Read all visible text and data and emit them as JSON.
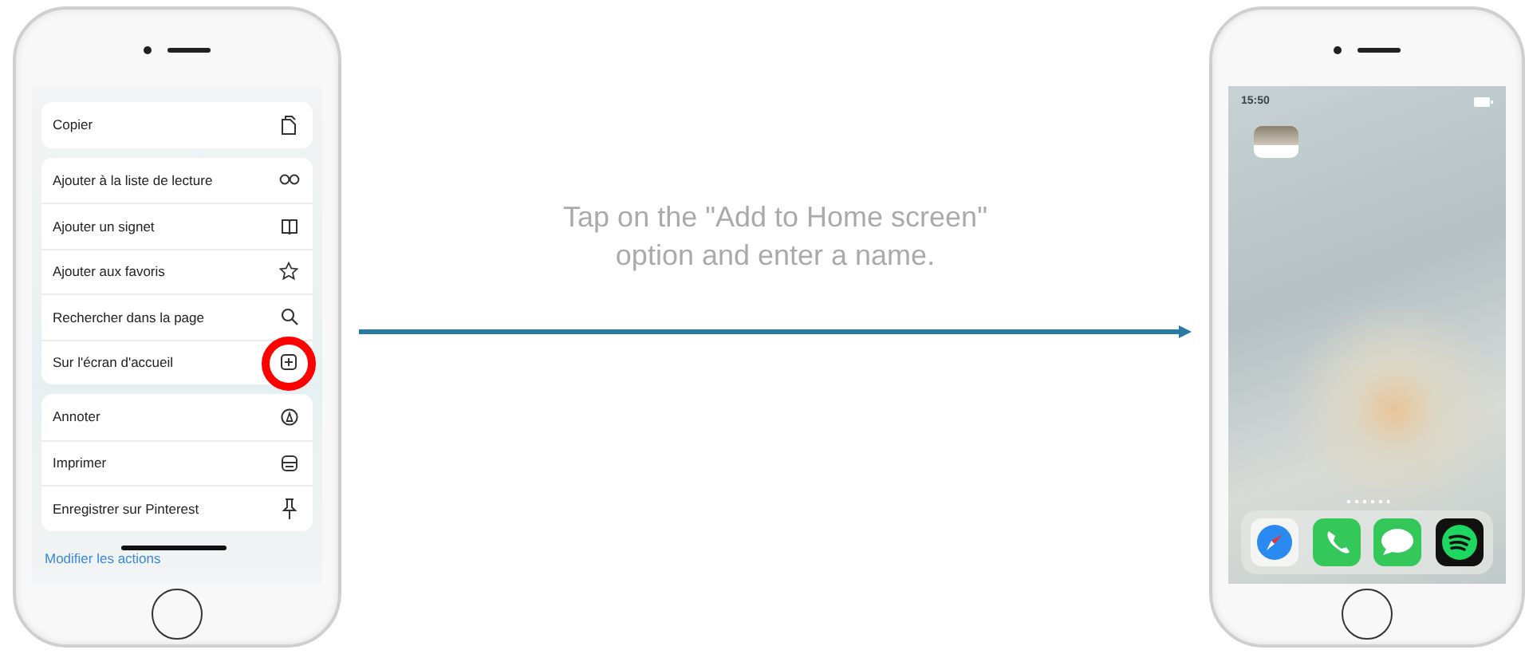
{
  "left_phone": {
    "menu_groups": [
      {
        "items": [
          {
            "label": "Copier",
            "kind": "copy",
            "highlighted": false
          }
        ]
      },
      {
        "items": [
          {
            "label": "Ajouter à la liste de lecture",
            "kind": "glasses",
            "highlighted": false
          },
          {
            "label": "Ajouter un signet",
            "kind": "book",
            "highlighted": false
          },
          {
            "label": "Ajouter aux favoris",
            "kind": "star",
            "highlighted": false
          },
          {
            "label": "Rechercher dans la page",
            "kind": "search",
            "highlighted": false
          },
          {
            "label": "Sur l'écran d'accueil",
            "kind": "add",
            "highlighted": true
          }
        ]
      },
      {
        "items": [
          {
            "label": "Annoter",
            "kind": "markup",
            "highlighted": false
          },
          {
            "label": "Imprimer",
            "kind": "print",
            "highlighted": false
          },
          {
            "label": "Enregistrer sur Pinterest",
            "kind": "pin",
            "highlighted": false
          }
        ]
      }
    ],
    "footer_link": "Modifier les actions"
  },
  "caption": "Tap on the \"Add to Home screen\" option and enter a name.",
  "right_phone": {
    "status_time": "15:50",
    "dock": [
      {
        "kind": "safari"
      },
      {
        "kind": "phone"
      },
      {
        "kind": "messages"
      },
      {
        "kind": "music"
      }
    ]
  }
}
